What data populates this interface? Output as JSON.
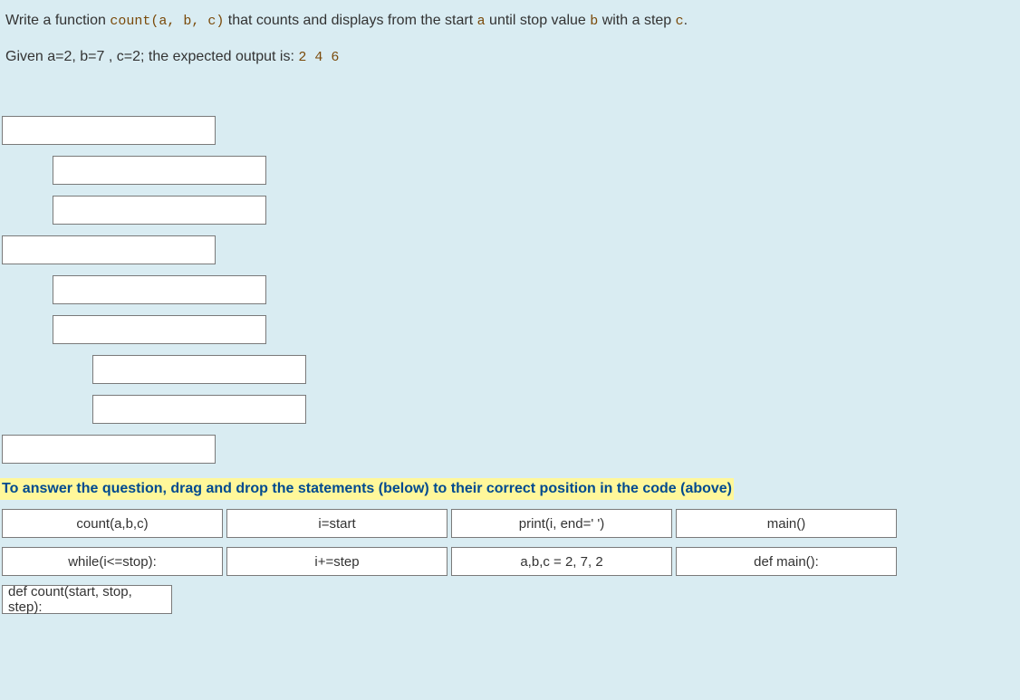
{
  "question": {
    "line1_pre": "Write a function ",
    "line1_code": "count(a, b, c)",
    "line1_mid": " that counts and displays from the start ",
    "var_a": "a",
    "line1_until": " until stop value  ",
    "var_b": "b",
    "line1_withstep": " with a step ",
    "var_c": "c",
    "line1_end": ".",
    "line2_pre": "Given  a=2, b=7 , c=2; the expected output is: ",
    "line2_output": "2 4 6"
  },
  "drop_slots": [
    {
      "indent": 0
    },
    {
      "indent": 1
    },
    {
      "indent": 1
    },
    {
      "indent": 0
    },
    {
      "indent": 1
    },
    {
      "indent": 1
    },
    {
      "indent": 2
    },
    {
      "indent": 2
    },
    {
      "indent": 0
    }
  ],
  "instruction": "To answer the question, drag and drop the statements (below) to their correct position in the code (above)",
  "options": {
    "row1": [
      {
        "label": "count(a,b,c)"
      },
      {
        "label": "i=start"
      },
      {
        "label": "print(i, end=' ')"
      },
      {
        "label": "main()"
      }
    ],
    "row2": [
      {
        "label": "while(i<=stop):"
      },
      {
        "label": "i+=step"
      },
      {
        "label": "a,b,c = 2, 7, 2"
      },
      {
        "label": "def main():"
      }
    ],
    "row3": [
      {
        "label": "def count(start, stop, step):"
      }
    ]
  }
}
